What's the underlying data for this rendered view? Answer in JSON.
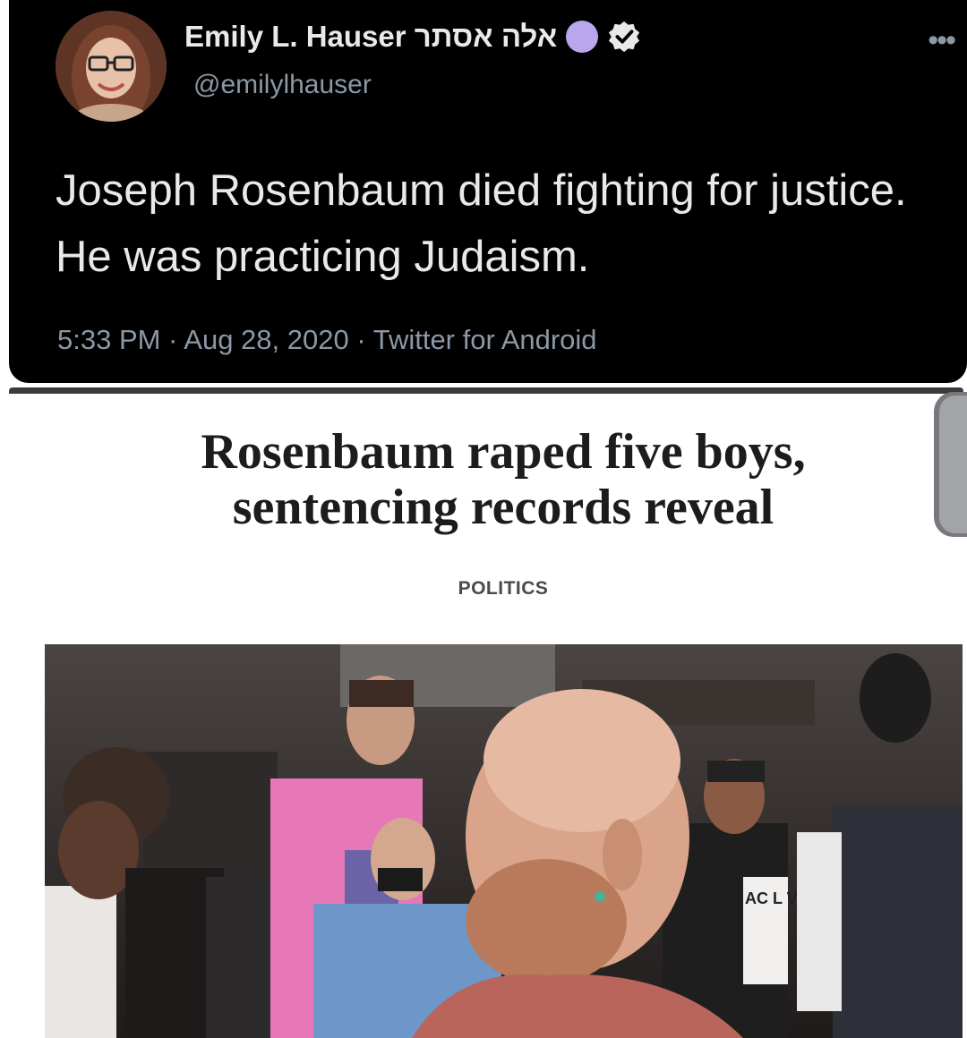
{
  "tweet": {
    "display_name": "Emily L. Hauser אלה אסתר",
    "handle": "@emilylhauser",
    "text": "Joseph Rosenbaum died fighting for justice. He was practicing Judaism.",
    "meta": "5:33 PM · Aug 28, 2020 · Twitter for Android",
    "more_icon": "more-options-icon",
    "verified_icon": "verified-badge-icon",
    "accent_dot_color": "#b9a6ec"
  },
  "article": {
    "headline": "Rosenbaum raped five boys, sentencing records reveal",
    "category": "POLITICS",
    "photo_sign_text": "AC L VE MA"
  },
  "colors": {
    "tweet_background": "#000000",
    "tweet_text": "#e7e9ea",
    "tweet_secondary": "#8b98a5",
    "headline": "#1c1c1c"
  }
}
